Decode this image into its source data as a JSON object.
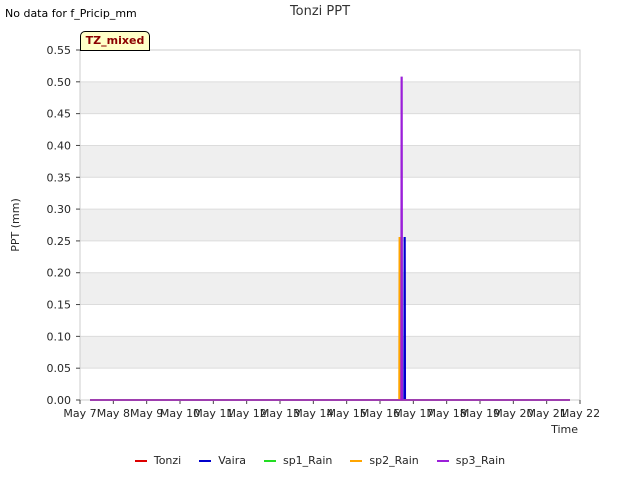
{
  "nodata_text": "No data for f_Pricip_mm",
  "badge_text": "TZ_mixed",
  "chart_data": {
    "type": "line",
    "title": "Tonzi PPT",
    "xlabel": "Time",
    "ylabel": "PPT (mm)",
    "ylim": [
      0,
      0.55
    ],
    "xlim": [
      7,
      22
    ],
    "yticks": [
      "0.00",
      "0.05",
      "0.10",
      "0.15",
      "0.20",
      "0.25",
      "0.30",
      "0.35",
      "0.40",
      "0.45",
      "0.50",
      "0.55"
    ],
    "xticks": [
      "May 7",
      "May 8",
      "May 9",
      "May 10",
      "May 11",
      "May 12",
      "May 13",
      "May 14",
      "May 15",
      "May 16",
      "May 17",
      "May 18",
      "May 19",
      "May 20",
      "May 21",
      "May 22"
    ],
    "grid": "alternating horizontal bands",
    "legend_placement": "bottom",
    "series": [
      {
        "name": "Tonzi",
        "color": "#dd0000",
        "x": [
          7.3,
          21.7
        ],
        "y": [
          0,
          0
        ]
      },
      {
        "name": "Vaira",
        "color": "#0000cc",
        "x": [
          7.3,
          16.72,
          16.73,
          16.75,
          16.76,
          21.7
        ],
        "y": [
          0,
          0,
          0.255,
          0.255,
          0,
          0
        ]
      },
      {
        "name": "sp1_Rain",
        "color": "#22dd22",
        "x": [
          7.3,
          21.7
        ],
        "y": [
          0,
          0
        ]
      },
      {
        "name": "sp2_Rain",
        "color": "#ffa500",
        "x": [
          7.3,
          16.57,
          16.58,
          16.6,
          16.61,
          21.7
        ],
        "y": [
          0,
          0,
          0.255,
          0.255,
          0,
          0
        ]
      },
      {
        "name": "sp3_Rain",
        "color": "#9b1fd9",
        "x": [
          7.3,
          16.63,
          16.64,
          16.66,
          16.67,
          21.7
        ],
        "y": [
          0,
          0,
          0.507,
          0.507,
          0,
          0
        ]
      }
    ]
  }
}
